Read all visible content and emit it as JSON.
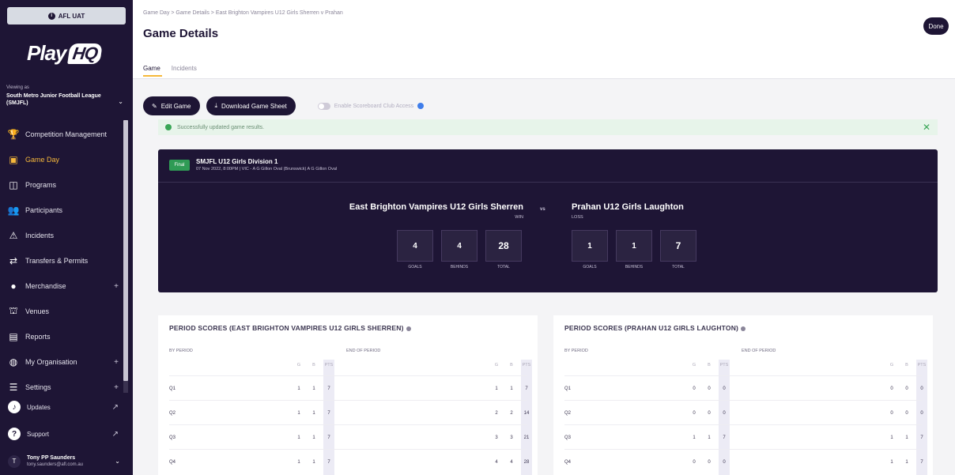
{
  "sidebar": {
    "env": "AFL UAT",
    "logo_text": "Play",
    "logo_hq": "HQ",
    "org_prefix": "Viewing as",
    "org_name": "South Metro Junior Football League (SMJFL)",
    "nav": [
      {
        "label": "Competition Management",
        "icon": "trophy-icon",
        "active": false
      },
      {
        "label": "Game Day",
        "icon": "scoreboard-icon",
        "active": true
      },
      {
        "label": "Programs",
        "icon": "book-icon",
        "active": false
      },
      {
        "label": "Participants",
        "icon": "people-icon",
        "active": false
      },
      {
        "label": "Incidents",
        "icon": "warning-icon",
        "active": false
      },
      {
        "label": "Transfers & Permits",
        "icon": "transfer-icon",
        "active": false
      },
      {
        "label": "Merchandise",
        "icon": "shirt-icon",
        "active": false
      },
      {
        "label": "Venues",
        "icon": "stadium-icon",
        "active": false
      },
      {
        "label": "Reports",
        "icon": "report-icon",
        "active": false
      },
      {
        "label": "My Organisation",
        "icon": "globe-icon",
        "active": false
      },
      {
        "label": "Settings",
        "icon": "sliders-icon",
        "active": false
      }
    ],
    "updates_label": "Updates",
    "support_label": "Support",
    "user_name": "Tony PP Saunders",
    "user_email": "tony.saunders@afl.com.au",
    "user_initial": "T"
  },
  "header": {
    "breadcrumb": "Game Day > Game Details > East Brighton Vampires U12 Girls Sherren v Prahan",
    "title": "Game Details",
    "done_label": "Done",
    "tabs": [
      "Game",
      "Incidents"
    ]
  },
  "actions": {
    "edit_label": "Edit Game",
    "download_label": "Download Game Sheet",
    "toggle_label": "Enable Scoreboard Club Access"
  },
  "alert": {
    "message": "Successfully updated game results."
  },
  "game": {
    "status": "Final",
    "competition": "SMJFL U12 Girls Division 1",
    "meta": "07 Nov 2022, 8:00PM | VIC - A G Gillon Oval (Brunswick) A G Gillon Oval",
    "vs": "vs",
    "home": {
      "name": "East Brighton Vampires U12 Girls Sherren",
      "result": "WIN",
      "goals": "4",
      "behinds": "4",
      "total": "28"
    },
    "away": {
      "name": "Prahan U12 Girls Laughton",
      "result": "LOSS",
      "goals": "1",
      "behinds": "1",
      "total": "7"
    },
    "labels": {
      "goals": "GOALS",
      "behinds": "BEHINDS",
      "total": "TOTAL"
    }
  },
  "periods": {
    "by_period_label": "BY PERIOD",
    "end_of_period_label": "END OF PERIOD",
    "cols": [
      "G",
      "B",
      "PTS"
    ],
    "home": {
      "title": "PERIOD SCORES (EAST BRIGHTON VAMPIRES U12 GIRLS SHERREN)",
      "rows": [
        {
          "q": "Q1",
          "g": "1",
          "b": "1",
          "p": "7",
          "eg": "1",
          "eb": "1",
          "ep": "7"
        },
        {
          "q": "Q2",
          "g": "1",
          "b": "1",
          "p": "7",
          "eg": "2",
          "eb": "2",
          "ep": "14"
        },
        {
          "q": "Q3",
          "g": "1",
          "b": "1",
          "p": "7",
          "eg": "3",
          "eb": "3",
          "ep": "21"
        },
        {
          "q": "Q4",
          "g": "1",
          "b": "1",
          "p": "7",
          "eg": "4",
          "eb": "4",
          "ep": "28"
        }
      ]
    },
    "away": {
      "title": "PERIOD SCORES (PRAHAN U12 GIRLS LAUGHTON)",
      "rows": [
        {
          "q": "Q1",
          "g": "0",
          "b": "0",
          "p": "0",
          "eg": "0",
          "eb": "0",
          "ep": "0"
        },
        {
          "q": "Q2",
          "g": "0",
          "b": "0",
          "p": "0",
          "eg": "0",
          "eb": "0",
          "ep": "0"
        },
        {
          "q": "Q3",
          "g": "1",
          "b": "1",
          "p": "7",
          "eg": "1",
          "eb": "1",
          "ep": "7"
        },
        {
          "q": "Q4",
          "g": "0",
          "b": "0",
          "p": "0",
          "eg": "1",
          "eb": "1",
          "ep": "7"
        }
      ]
    }
  },
  "colors": {
    "brand_dark": "#1e1535",
    "accent": "#f6b83b",
    "success": "#3aa657",
    "final_badge": "#2f9b55"
  }
}
